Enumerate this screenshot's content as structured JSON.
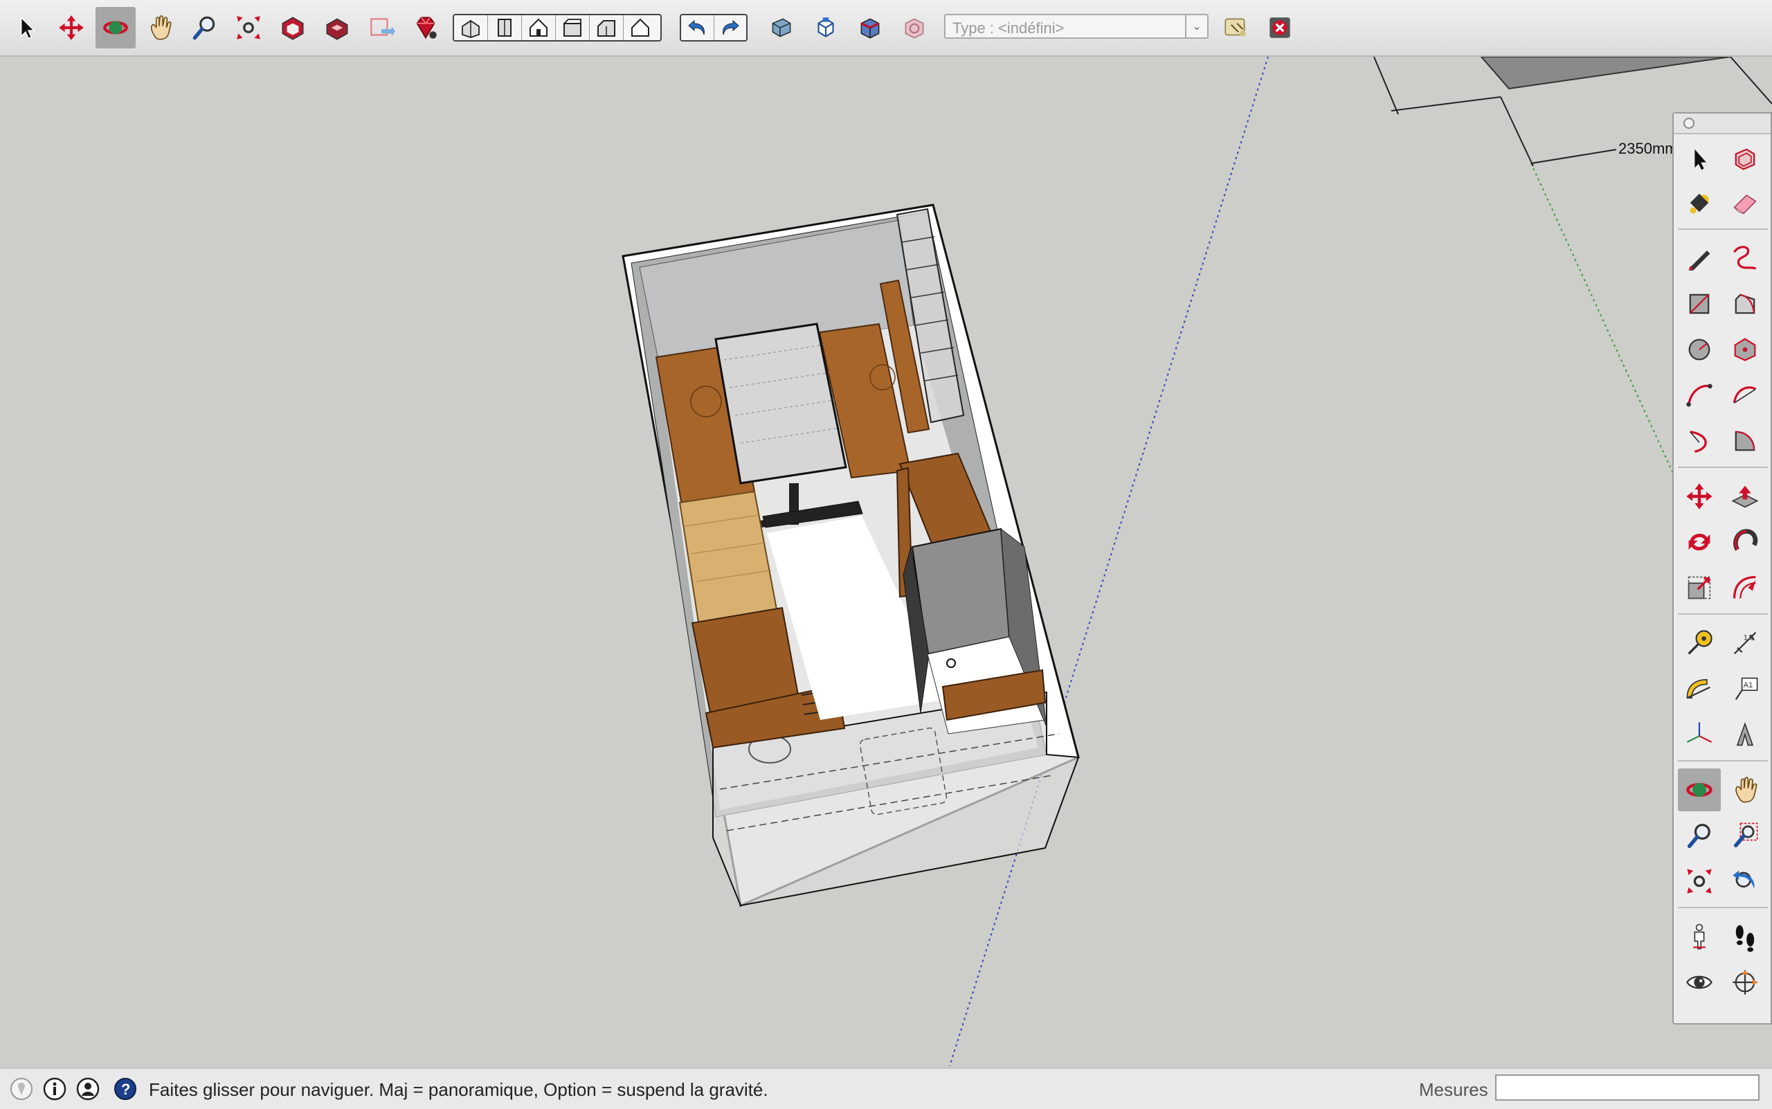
{
  "toolbar": {
    "type_select": {
      "value": "Type : <indéfini>"
    }
  },
  "viewport": {
    "dimension_label": "2350mm"
  },
  "statusbar": {
    "hint": "Faites glisser pour naviguer. Maj = panoramique, Option =  suspend la gravité.",
    "measures_label": "Mesures",
    "measures_value": ""
  },
  "colors": {
    "background": "#cdcdc9",
    "wood": "#a8652a",
    "light_wood": "#d8b070",
    "accent_red": "#d0102a"
  }
}
